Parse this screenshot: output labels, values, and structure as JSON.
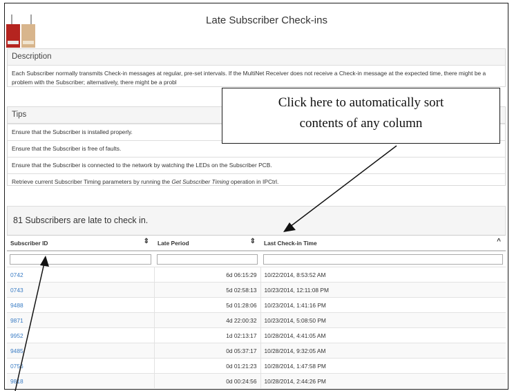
{
  "page": {
    "title": "Late Subscriber Check-ins"
  },
  "description": {
    "heading": "Description",
    "text": "Each Subscriber normally transmits Check-in messages at regular, pre-set intervals. If the MultiNet Receiver does not receive a Check-in message at the expected time, there might be a problem with the Subscriber; alternatively, there might be a probl"
  },
  "tips": {
    "heading": "Tips",
    "items": [
      "Ensure that the Subscriber is installed properly.",
      "Ensure that the Subscriber is free of faults.",
      "Ensure that the Subscriber is connected to the network by watching the LEDs on the Subscriber PCB."
    ],
    "last_prefix": "Retrieve current Subscriber Timing parameters by running the ",
    "last_emphasis": "Get Subscriber Timing",
    "last_suffix": " operation in IPCtrl."
  },
  "callout": {
    "line1": "Click here to automatically sort",
    "line2": "contents of any column"
  },
  "summary": "81 Subscribers are late to check in.",
  "table": {
    "columns": [
      "Subscriber ID",
      "Late Period",
      "Last Check-in Time"
    ],
    "sort_icons": [
      "⇕",
      "⇕",
      "^"
    ],
    "rows": [
      {
        "id": "0742",
        "period": "6d 06:15:29",
        "last": "10/22/2014, 8:53:52 AM"
      },
      {
        "id": "0743",
        "period": "5d 02:58:13",
        "last": "10/23/2014, 12:11:08 PM"
      },
      {
        "id": "9488",
        "period": "5d 01:28:06",
        "last": "10/23/2014, 1:41:16 PM"
      },
      {
        "id": "9871",
        "period": "4d 22:00:32",
        "last": "10/23/2014, 5:08:50 PM"
      },
      {
        "id": "9952",
        "period": "1d 02:13:17",
        "last": "10/28/2014, 4:41:05 AM"
      },
      {
        "id": "9485",
        "period": "0d 05:37:17",
        "last": "10/28/2014, 9:32:05 AM"
      },
      {
        "id": "0756",
        "period": "0d 01:21:23",
        "last": "10/28/2014, 1:47:58 PM"
      },
      {
        "id": "9818",
        "period": "0d 00:24:56",
        "last": "10/28/2014, 2:44:26 PM"
      }
    ]
  },
  "colors": {
    "link": "#3a7cc4",
    "panel_head": "#f5f5f5",
    "border": "#dddddd"
  },
  "icons": {
    "device": "subscriber-device-image",
    "sort": "sort-updown-icon"
  }
}
